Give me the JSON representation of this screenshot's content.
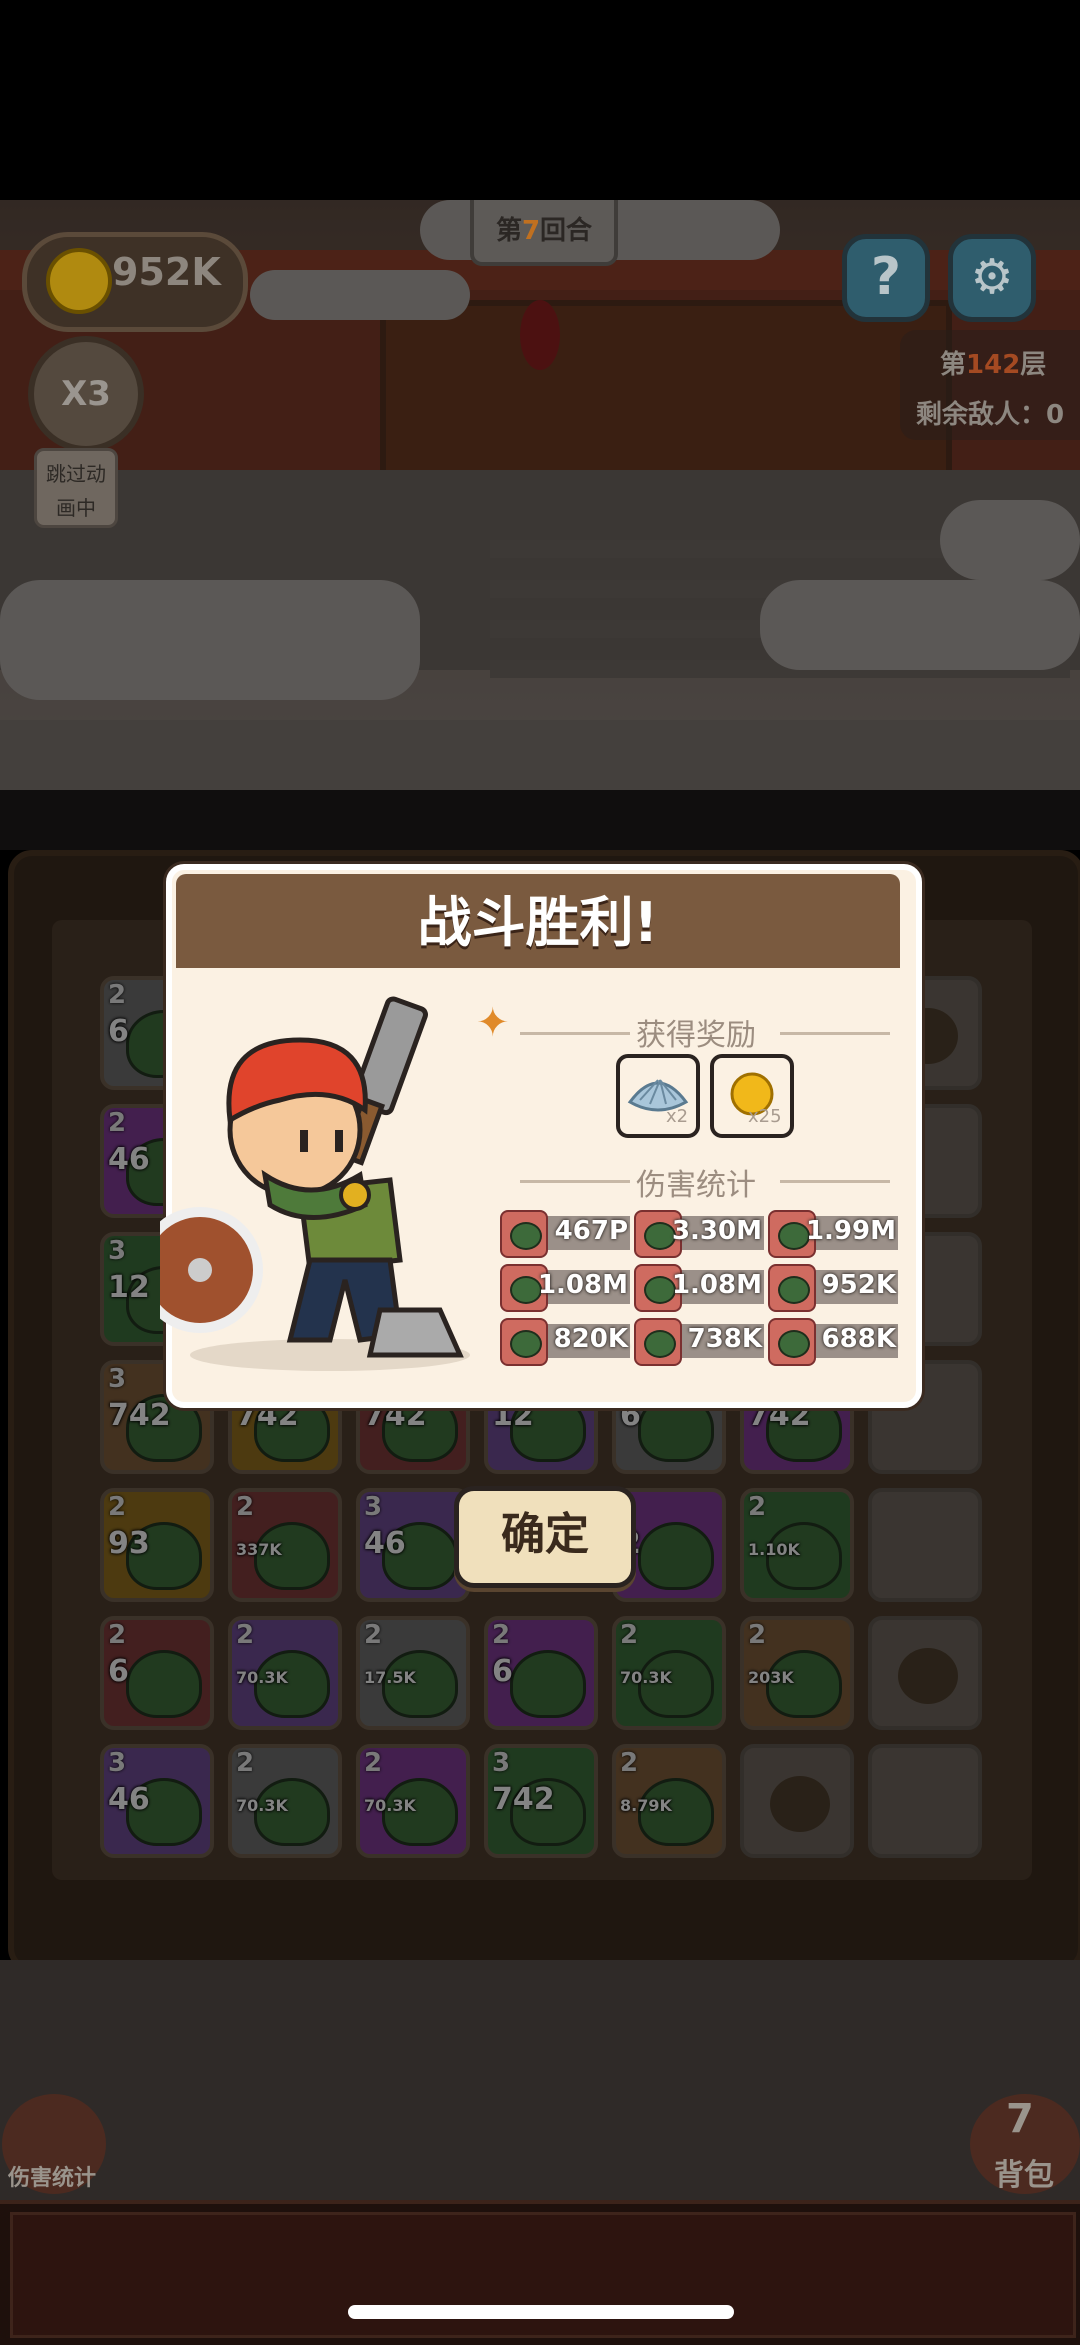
{
  "hud": {
    "coins": "952K",
    "round_prefix": "第",
    "round_number": "7",
    "round_suffix": "回合",
    "speed_label": "X3",
    "skip_line1": "跳过动",
    "skip_line2": "画中",
    "help_label": "?",
    "floor_prefix": "第",
    "floor_number": "142",
    "floor_suffix": "层",
    "enemies_text": "剩余敌人：0"
  },
  "dialog": {
    "title": "战斗胜利!",
    "rewards_title": "获得奖励",
    "rewards": [
      {
        "icon": "clam-shell-icon",
        "qty": "x2"
      },
      {
        "icon": "gold-coin-icon",
        "qty": "x25"
      }
    ],
    "damage_title": "伤害统计",
    "damage": [
      [
        "467P",
        "3.30M",
        "1.99M"
      ],
      [
        "1.08M",
        "1.08M",
        "952K"
      ],
      [
        "820K",
        "738K",
        "688K"
      ]
    ],
    "confirm_label": "确定"
  },
  "board": {
    "rows": [
      [
        {
          "lvl": "2",
          "num": "6"
        },
        null,
        null,
        null,
        null,
        null,
        "dust"
      ],
      [
        {
          "lvl": "2",
          "num": "46"
        },
        null,
        null,
        null,
        null,
        null,
        "flower"
      ],
      [
        {
          "lvl": "3",
          "num": "12"
        },
        null,
        null,
        null,
        null,
        null,
        "flower"
      ],
      [
        {
          "lvl": "3",
          "num": "742"
        },
        {
          "lvl": "",
          "num": "742"
        },
        {
          "lvl": "",
          "num": "742"
        },
        {
          "lvl": "",
          "num": "12"
        },
        {
          "lvl": "",
          "num": "6"
        },
        {
          "lvl": "",
          "num": "742"
        },
        "flower"
      ],
      [
        {
          "lvl": "2",
          "num": "93"
        },
        {
          "lvl": "2",
          "num": "337K"
        },
        {
          "lvl": "3",
          "num": "46"
        },
        null,
        {
          "lvl": "",
          "num": "2"
        },
        {
          "lvl": "2",
          "num": "1.10K"
        },
        "flower"
      ],
      [
        {
          "lvl": "2",
          "num": "6"
        },
        {
          "lvl": "2",
          "num": "70.3K"
        },
        {
          "lvl": "2",
          "num": "17.5K"
        },
        {
          "lvl": "2",
          "num": "6"
        },
        {
          "lvl": "2",
          "num": "70.3K"
        },
        {
          "lvl": "2",
          "num": "203K"
        },
        "dust"
      ],
      [
        {
          "lvl": "3",
          "num": "46"
        },
        {
          "lvl": "2",
          "num": "70.3K"
        },
        {
          "lvl": "2",
          "num": "70.3K"
        },
        {
          "lvl": "3",
          "num": "742"
        },
        {
          "lvl": "2",
          "num": "8.79K"
        },
        "dust",
        "flower"
      ]
    ]
  },
  "bottom": {
    "damage_stats_label": "伤害统计",
    "bag_count": "7",
    "bag_label": "背包"
  },
  "colors": {
    "dialog_header": "#7a5a3f",
    "dialog_bg": "#fbf1e3",
    "accent_orange": "#c07020",
    "settings_teal": "#2f5d6d"
  }
}
